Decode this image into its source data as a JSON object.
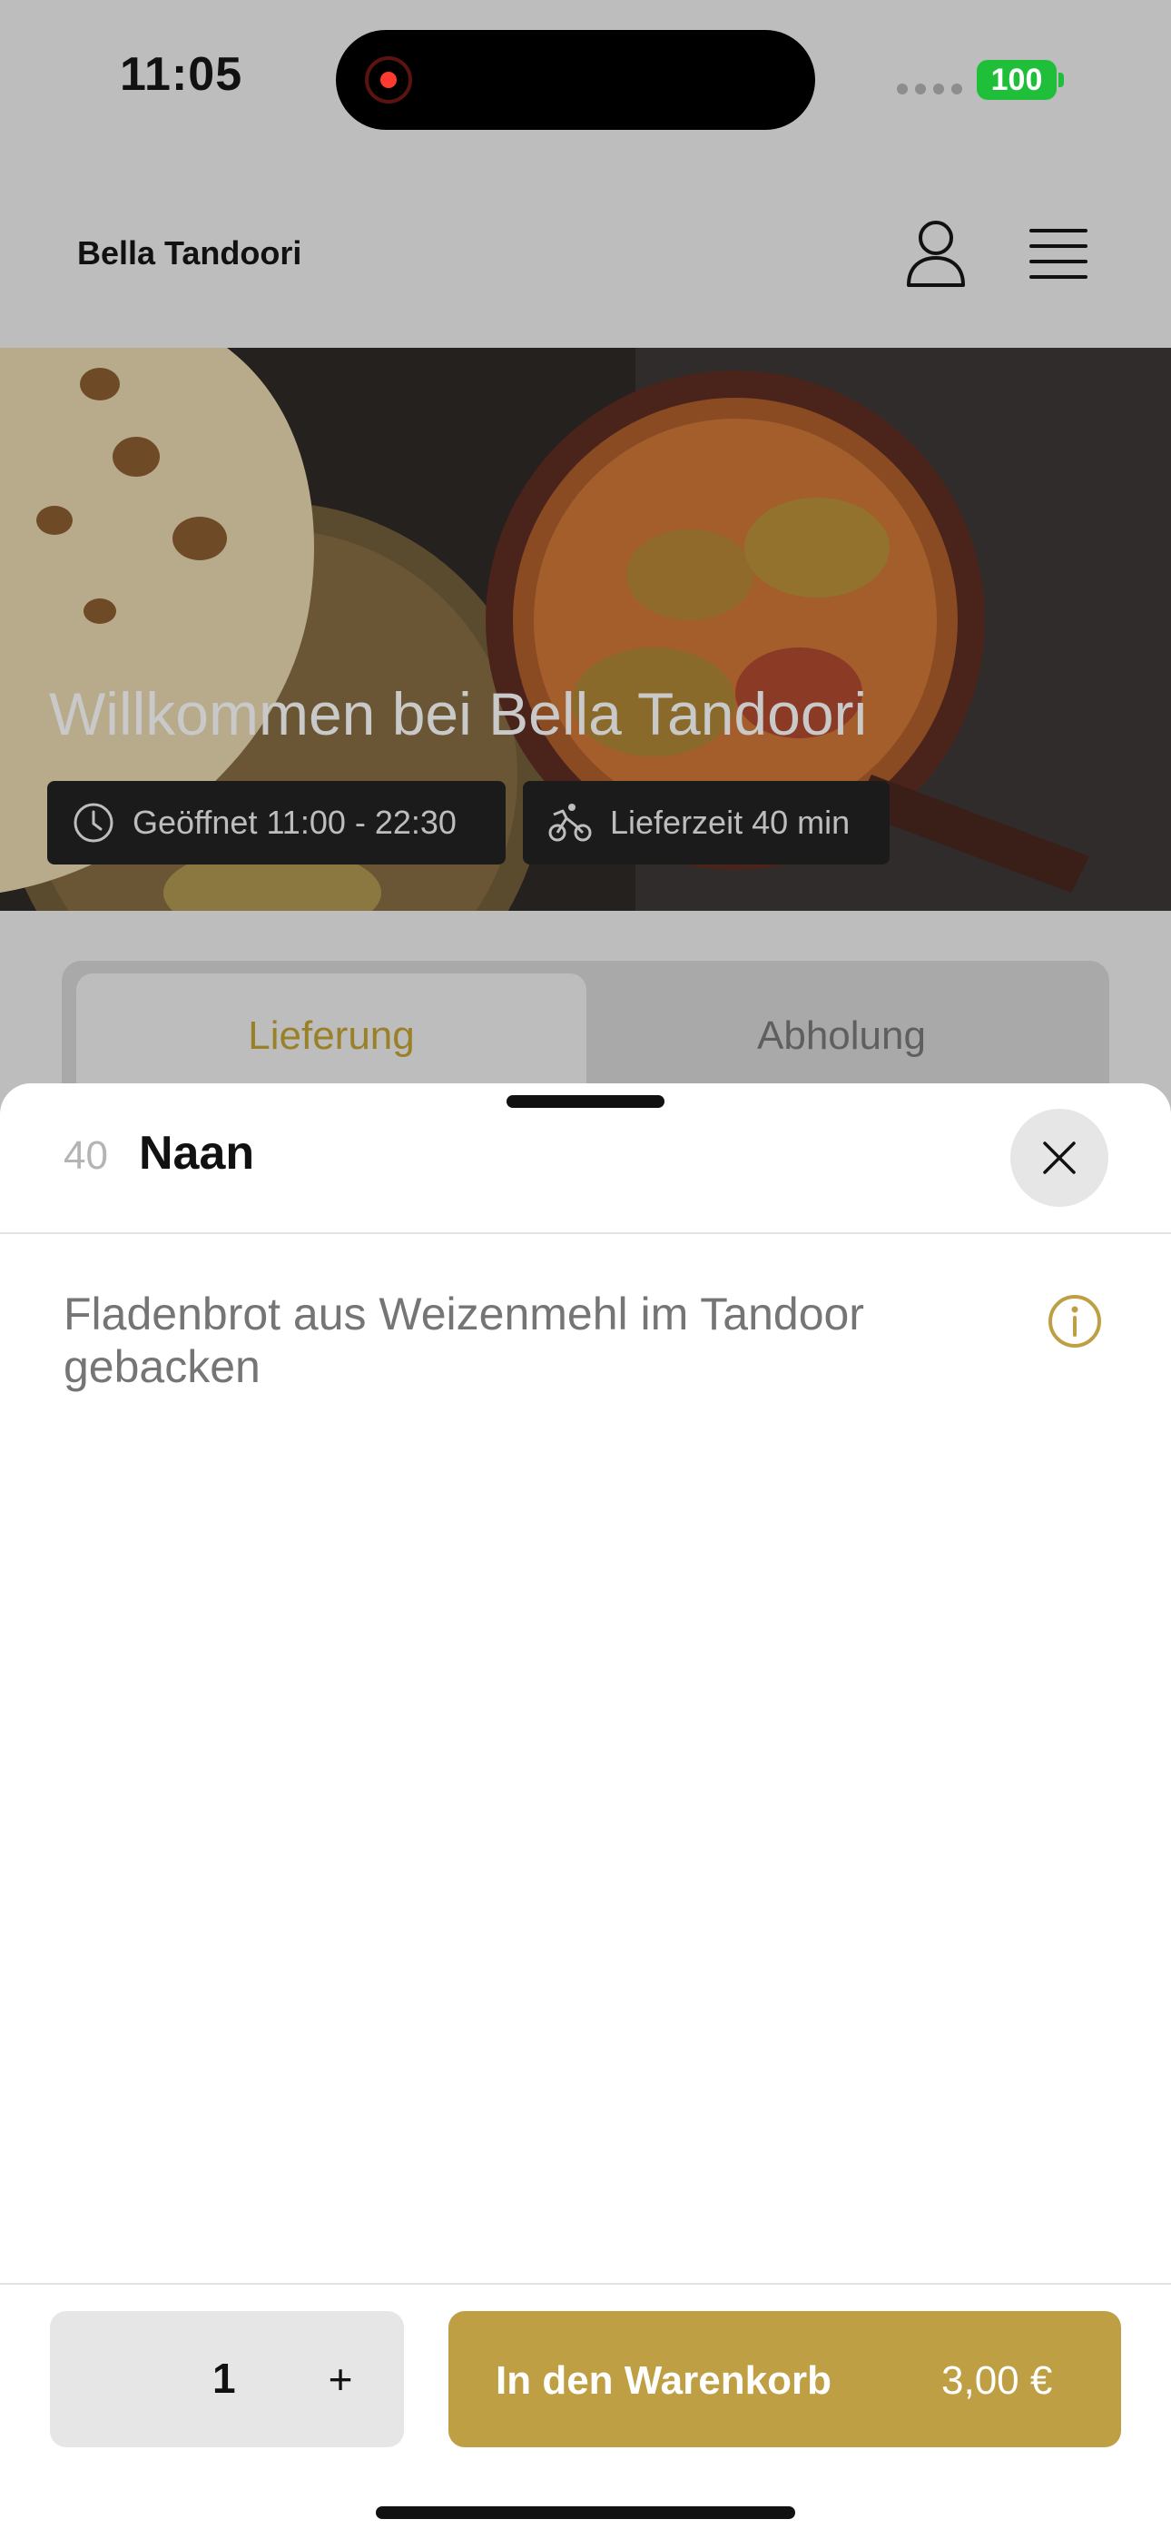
{
  "status_bar": {
    "time": "11:05",
    "battery": "100"
  },
  "header": {
    "brand": "Bella Tandoori"
  },
  "hero": {
    "title": "Willkommen bei Bella Tandoori",
    "opening_hours": "Geöffnet 11:00 - 22:30",
    "delivery_time": "Lieferzeit 40 min"
  },
  "tabs": [
    {
      "label": "Lieferung",
      "active": true
    },
    {
      "label": "Abholung",
      "active": false
    }
  ],
  "sheet": {
    "item_number": "40",
    "item_name": "Naan",
    "description": "Fladenbrot aus Weizenmehl im Tandoor gebacken"
  },
  "footer": {
    "quantity": "1",
    "plus_label": "+",
    "add_label": "In den Warenkorb",
    "price": "3,00 €"
  },
  "colors": {
    "accent": "#bf9f43",
    "accent_text": "#9a8028",
    "overlay": "#bdbdbd"
  },
  "icons": [
    "record-icon",
    "signal-icon",
    "battery-icon",
    "user-icon",
    "menu-icon",
    "clock-icon",
    "bicycle-icon",
    "close-icon",
    "info-icon"
  ]
}
